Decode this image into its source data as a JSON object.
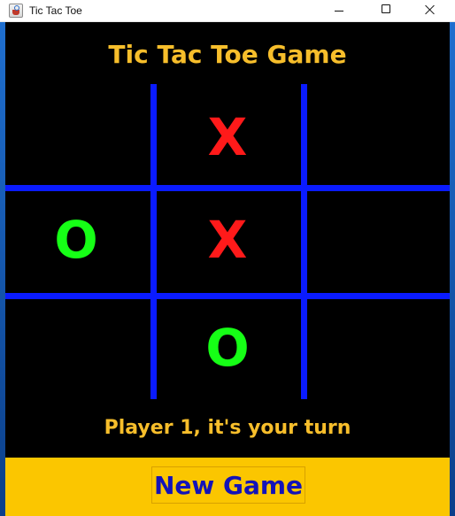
{
  "window": {
    "title": "Tic Tac Toe",
    "icon": "java-cup-icon"
  },
  "game": {
    "title": "Tic Tac Toe Game",
    "board": [
      "",
      "X",
      "",
      "O",
      "X",
      "",
      "",
      "O",
      ""
    ],
    "status": "Player 1, it's your turn",
    "new_game_label": "New Game"
  },
  "colors": {
    "background": "#000000",
    "grid": "#0a1bff",
    "title_text": "#f7be2b",
    "x_mark": "#ff1a1a",
    "o_mark": "#16ff16",
    "button_bar": "#fbc600",
    "button_text": "#1313b8"
  }
}
